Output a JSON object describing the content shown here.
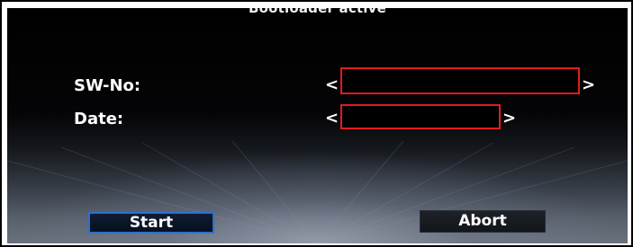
{
  "header": {
    "title": "Bootloader active"
  },
  "fields": {
    "sw_no": {
      "label": "SW-No:",
      "open_bracket": "<",
      "close_bracket": ">"
    },
    "date": {
      "label": "Date:",
      "open_bracket": "<",
      "close_bracket": ">"
    }
  },
  "buttons": {
    "start_label": "Start",
    "abort_label": "Abort"
  },
  "colors": {
    "redaction_border": "#e31b1b",
    "start_button_border": "#2d6ecf",
    "frame_border": "#000000"
  }
}
